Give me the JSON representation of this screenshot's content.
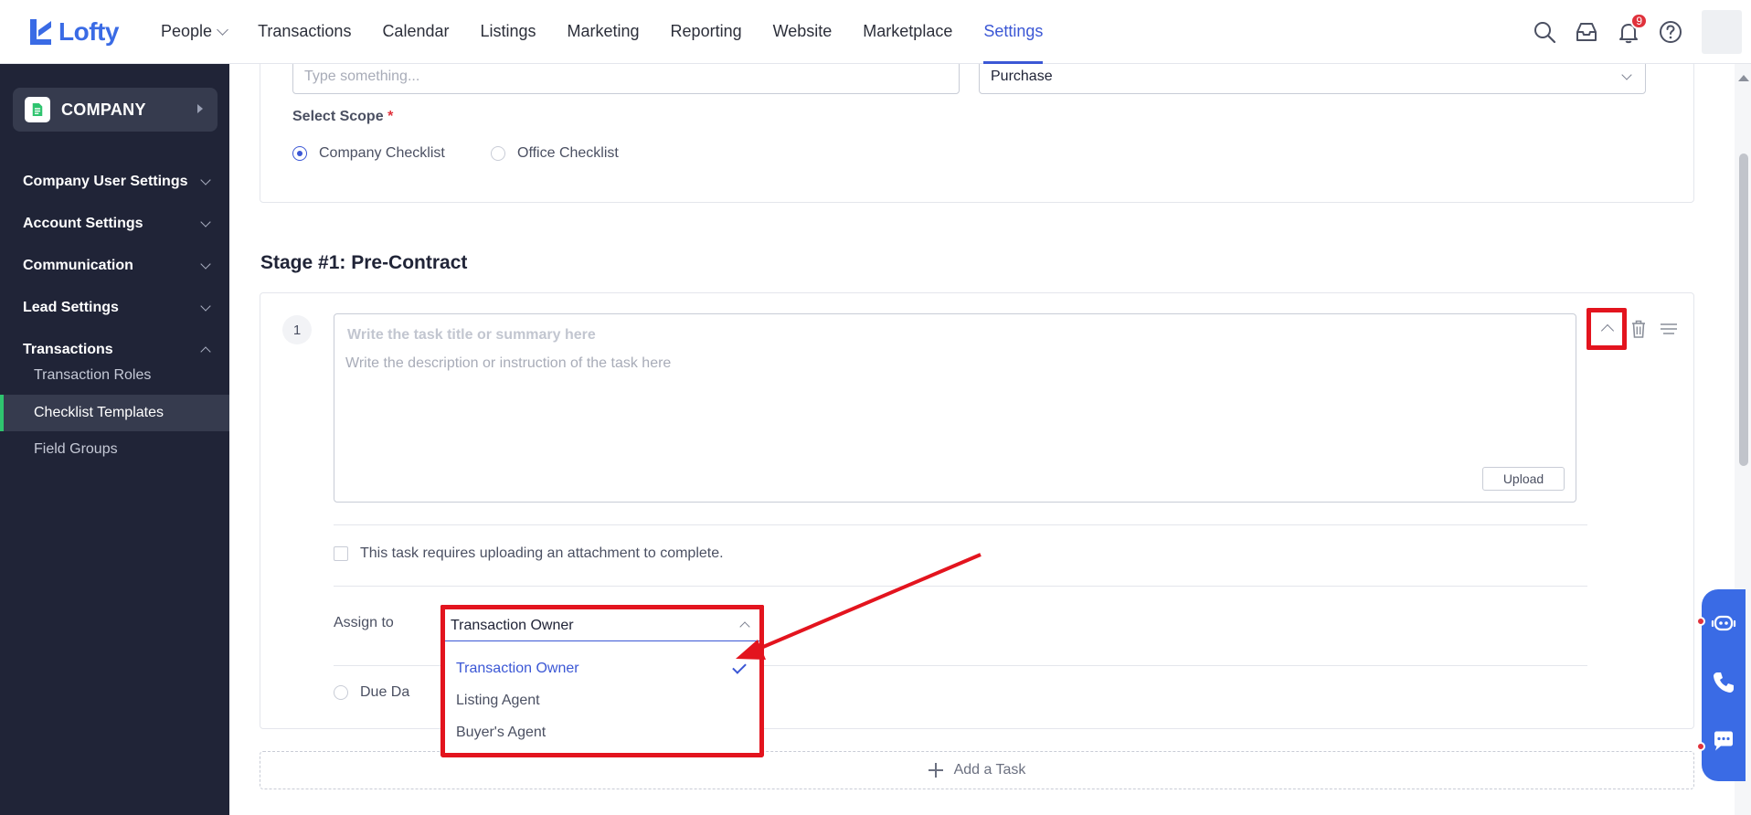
{
  "brand": {
    "name": "Lofty",
    "color": "#3a6be5"
  },
  "nav": {
    "items": [
      {
        "label": "People",
        "has_dropdown": true
      },
      {
        "label": "Transactions"
      },
      {
        "label": "Calendar"
      },
      {
        "label": "Listings"
      },
      {
        "label": "Marketing"
      },
      {
        "label": "Reporting"
      },
      {
        "label": "Website"
      },
      {
        "label": "Marketplace"
      },
      {
        "label": "Settings",
        "active": true
      }
    ],
    "notification_count": "9",
    "icons": [
      "search-icon",
      "inbox-icon",
      "bell-icon",
      "help-icon"
    ]
  },
  "sidebar": {
    "company_label": "COMPANY",
    "sections": [
      {
        "label": "Company User Settings",
        "expanded": false
      },
      {
        "label": "Account Settings",
        "expanded": false
      },
      {
        "label": "Communication",
        "expanded": false
      },
      {
        "label": "Lead Settings",
        "expanded": false
      },
      {
        "label": "Transactions",
        "expanded": true
      }
    ],
    "sub_items": [
      {
        "label": "Transaction Roles"
      },
      {
        "label": "Checklist Templates",
        "active": true
      },
      {
        "label": "Field Groups"
      }
    ],
    "active_color": "#2fc46f"
  },
  "form": {
    "name_placeholder": "Type something...",
    "type_value": "Purchase",
    "scope_label": "Select Scope",
    "required_mark": "*",
    "scope_options": [
      {
        "label": "Company Checklist",
        "selected": true
      },
      {
        "label": "Office Checklist",
        "selected": false
      }
    ]
  },
  "stage": {
    "title": "Stage #1: Pre-Contract",
    "task": {
      "number": "1",
      "title_placeholder": "Write the task title or summary here",
      "description_placeholder": "Write the description or instruction of the task here",
      "upload_label": "Upload",
      "attachment_label": "This task requires uploading an attachment to complete.",
      "assign_label": "Assign to",
      "assign_value": "Transaction Owner",
      "assign_options": [
        {
          "label": "Transaction Owner",
          "selected": true
        },
        {
          "label": "Listing Agent",
          "selected": false
        },
        {
          "label": "Buyer's Agent",
          "selected": false
        }
      ],
      "due_label_visible": "Due Da"
    },
    "add_task_label": "Add a Task"
  },
  "colors": {
    "accent": "#3b57d5",
    "highlight": "#e3141e",
    "sidebar_bg": "#202437"
  }
}
